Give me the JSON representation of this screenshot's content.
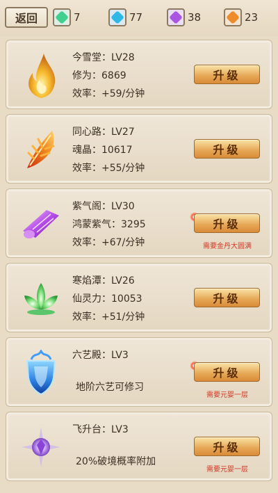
{
  "topbar": {
    "back_label": "返回",
    "resources": [
      {
        "icon": "green-gem-icon",
        "color": "#3fcf8e",
        "value": "7"
      },
      {
        "icon": "cyan-gem-icon",
        "color": "#2fb7e6",
        "value": "77"
      },
      {
        "icon": "purple-gem-icon",
        "color": "#a957e0",
        "value": "38"
      },
      {
        "icon": "orange-gem-icon",
        "color": "#ee8c2c",
        "value": "23"
      }
    ]
  },
  "cards": [
    {
      "icon": "golden-flame-icon",
      "name_line": "今雪堂：LV28",
      "stat_line": "修为：6869",
      "rate_line": "效率：+59/分钟",
      "button": "升级"
    },
    {
      "icon": "fire-feather-icon",
      "name_line": "同心路：LV27",
      "stat_line": "魂晶：10617",
      "rate_line": "效率：+55/分钟",
      "button": "升级"
    },
    {
      "icon": "purple-scroll-icon",
      "name_line": "紫气阁：LV30",
      "stat_line": "鸿蒙紫气：3295",
      "rate_line": "效率：+67/分钟",
      "button": "升级",
      "requirement": "需要金丹大圆满"
    },
    {
      "icon": "green-lotus-icon",
      "name_line": "寒焰潭：LV26",
      "stat_line": "仙灵力：10053",
      "rate_line": "效率：+51/分钟",
      "button": "升级"
    },
    {
      "icon": "blue-shield-icon",
      "name_line": "六艺殿：LV3",
      "desc_line": "地阶六艺可修习",
      "button": "升级",
      "requirement": "需要元婴一层"
    },
    {
      "icon": "purple-crystal-icon",
      "name_line": "飞升台：LV3",
      "desc_line": "20%破境概率附加",
      "button": "升级",
      "requirement": "需要元婴一层"
    }
  ]
}
